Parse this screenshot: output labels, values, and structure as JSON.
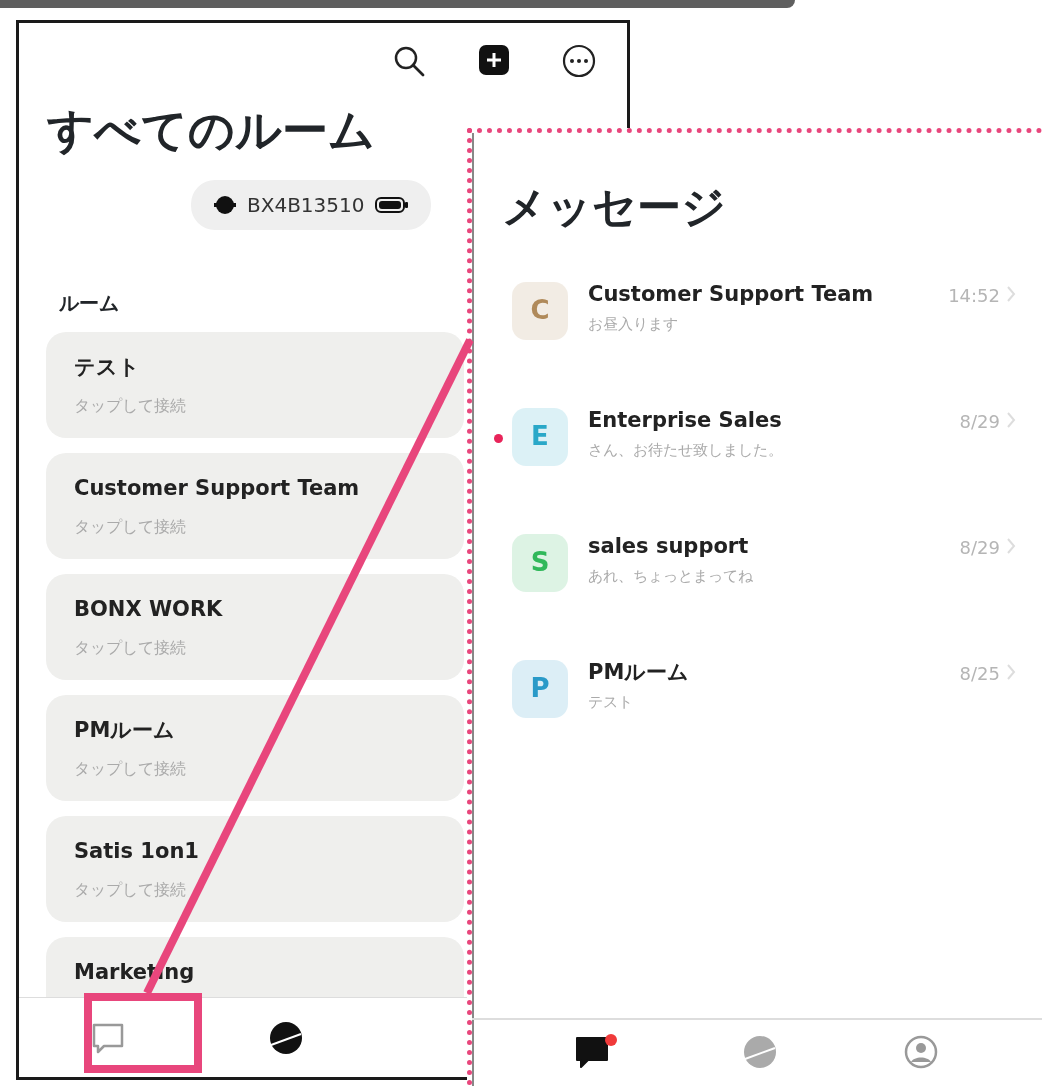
{
  "left_screen": {
    "title": "すべてのルーム",
    "device": {
      "name": "BX4B13510"
    },
    "section_label": "ルーム",
    "rooms": [
      {
        "name": "テスト",
        "status": "タップして接続"
      },
      {
        "name": "Customer Support Team",
        "status": "タップして接続"
      },
      {
        "name": "BONX WORK",
        "status": "タップして接続"
      },
      {
        "name": "PMルーム",
        "status": "タップして接続"
      },
      {
        "name": "Satis 1on1",
        "status": "タップして接続"
      },
      {
        "name": "Marketing"
      }
    ],
    "tabs": [
      {
        "kind": "chat",
        "selected": false,
        "highlighted": true
      },
      {
        "kind": "planet",
        "selected": true,
        "highlighted": false
      }
    ]
  },
  "right_screen": {
    "title": "メッセージ",
    "conversations": [
      {
        "initial": "C",
        "color": "#b08a5a",
        "name": "Customer Support Team",
        "preview": "お昼入ります",
        "time": "14:52",
        "unread": false
      },
      {
        "initial": "E",
        "color": "#2aa8c8",
        "name": "Enterprise Sales",
        "preview": "さん、お待たせ致しました。",
        "time": "8/29",
        "unread": true
      },
      {
        "initial": "S",
        "color": "#30b85a",
        "name": "sales support",
        "preview": "あれ、ちょっとまってね",
        "time": "8/29",
        "unread": false
      },
      {
        "initial": "P",
        "color": "#2a9ac8",
        "name": "PMルーム",
        "preview": "テスト",
        "time": "8/25",
        "unread": false
      }
    ],
    "tabs": [
      {
        "kind": "chat",
        "selected": true,
        "badge": true
      },
      {
        "kind": "planet",
        "selected": false,
        "badge": false
      },
      {
        "kind": "profile",
        "selected": false,
        "badge": false
      }
    ]
  }
}
